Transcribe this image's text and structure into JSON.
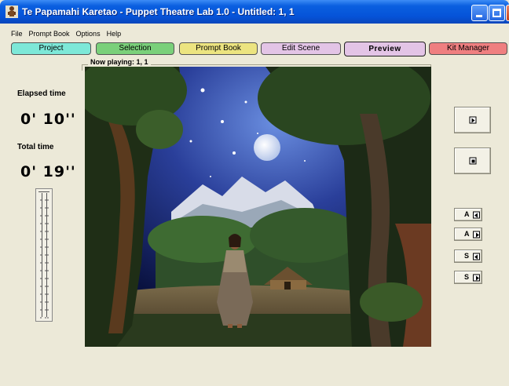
{
  "window": {
    "title": "Te Papamahi Karetao - Puppet Theatre Lab 1.0 - Untitled: 1, 1"
  },
  "menu": [
    {
      "label": "File"
    },
    {
      "label": "Prompt Book"
    },
    {
      "label": "Options"
    },
    {
      "label": "Help"
    }
  ],
  "tabs": [
    {
      "label": "Project",
      "color": "#7de8d8"
    },
    {
      "label": "Selection",
      "color": "#7ad07a"
    },
    {
      "label": "Prompt Book",
      "color": "#ece480"
    },
    {
      "label": "Edit Scene",
      "color": "#e3c4e6"
    },
    {
      "label": "Preview",
      "color": "#e3c4e6",
      "active": true
    },
    {
      "label": "Kit Manager",
      "color": "#ef7f80"
    }
  ],
  "now_playing": {
    "label": "Now playing: 1, 1"
  },
  "timer": {
    "elapsed_label": "Elapsed time",
    "elapsed_value": "0' 10''",
    "total_label": "Total time",
    "total_value": "0' 19''",
    "slider_position": 0.0
  },
  "controls": {
    "play": {
      "icon": "play-icon"
    },
    "stop": {
      "icon": "stop-icon"
    },
    "a_back": {
      "key": "A",
      "icon": "step-back-icon"
    },
    "a_forward": {
      "key": "A",
      "icon": "step-forward-icon"
    },
    "s_back": {
      "key": "S",
      "icon": "step-back-icon"
    },
    "s_forward": {
      "key": "S",
      "icon": "step-forward-icon"
    }
  }
}
